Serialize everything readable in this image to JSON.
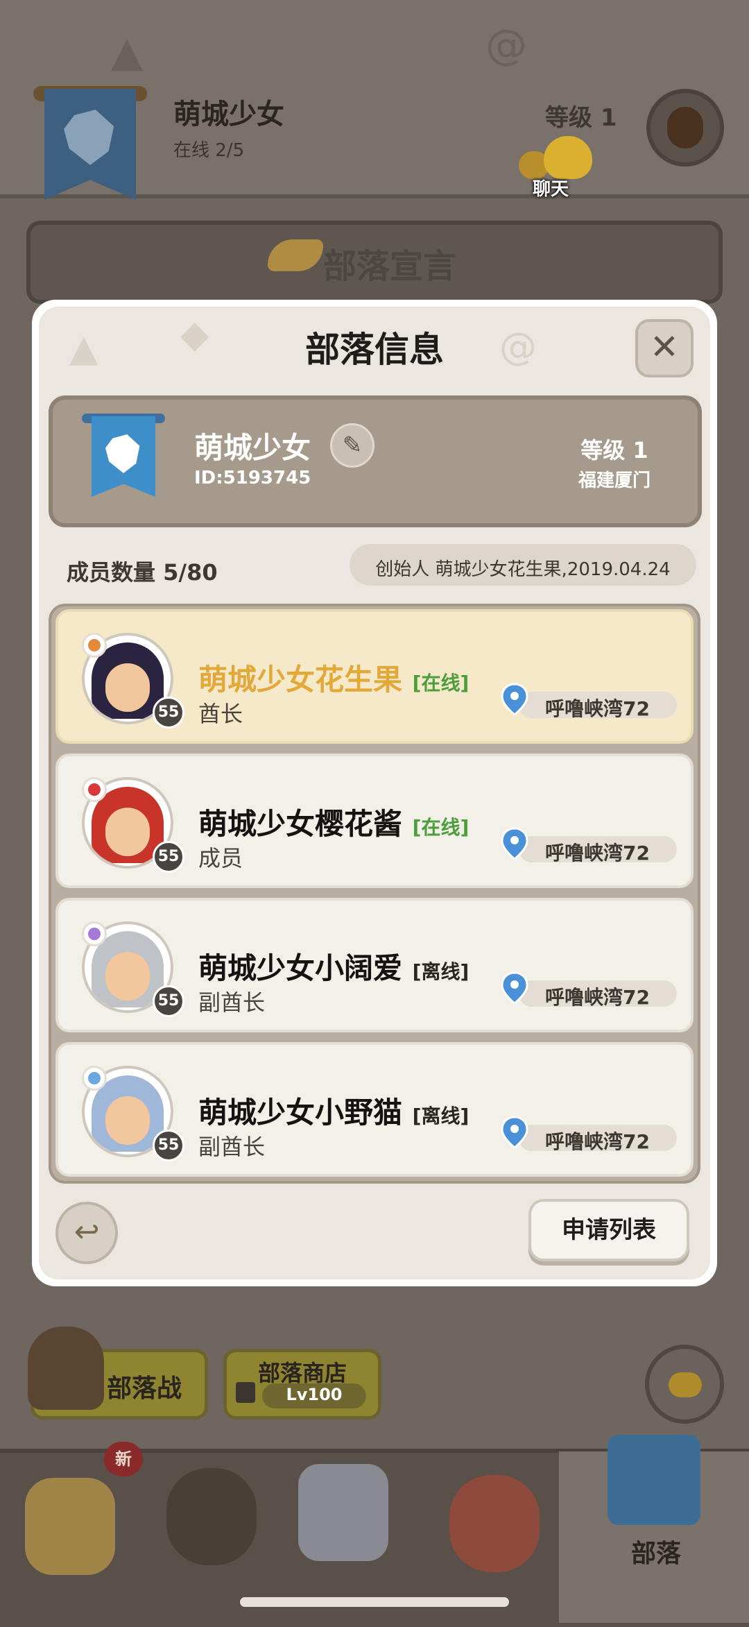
{
  "background": {
    "tribe_name": "萌城少女",
    "online": "在线 2/5",
    "level": "等级 1",
    "chat_label": "聊天",
    "manifesto_title": "部落宣言",
    "war_button": "部落战",
    "shop_button": "部落商店",
    "shop_level": "Lv100",
    "nav": {
      "new_badge": "新",
      "tribe_label": "部落"
    }
  },
  "modal": {
    "title": "部落信息",
    "close_glyph": "✕",
    "card": {
      "name": "萌城少女",
      "id": "ID:5193745",
      "level": "等级 1",
      "region": "福建厦门"
    },
    "member_count": "成员数量 5/80",
    "founder": "创始人 萌城少女花生果,2019.04.24",
    "members": [
      {
        "name": "萌城少女花生果",
        "status": "[在线]",
        "role": "酋长",
        "level": "55",
        "location": "呼噜峡湾72"
      },
      {
        "name": "萌城少女樱花酱",
        "status": "[在线]",
        "role": "成员",
        "level": "55",
        "location": "呼噜峡湾72"
      },
      {
        "name": "萌城少女小阔爱",
        "status": "[离线]",
        "role": "副酋长",
        "level": "55",
        "location": "呼噜峡湾72"
      },
      {
        "name": "萌城少女小野猫",
        "status": "[离线]",
        "role": "副酋长",
        "level": "55",
        "location": "呼噜峡湾72"
      }
    ],
    "apply_list": "申请列表"
  },
  "colors": {
    "leader_name": "#e2a93a",
    "online": "#4c9e3c",
    "offline": "#2b2520"
  }
}
